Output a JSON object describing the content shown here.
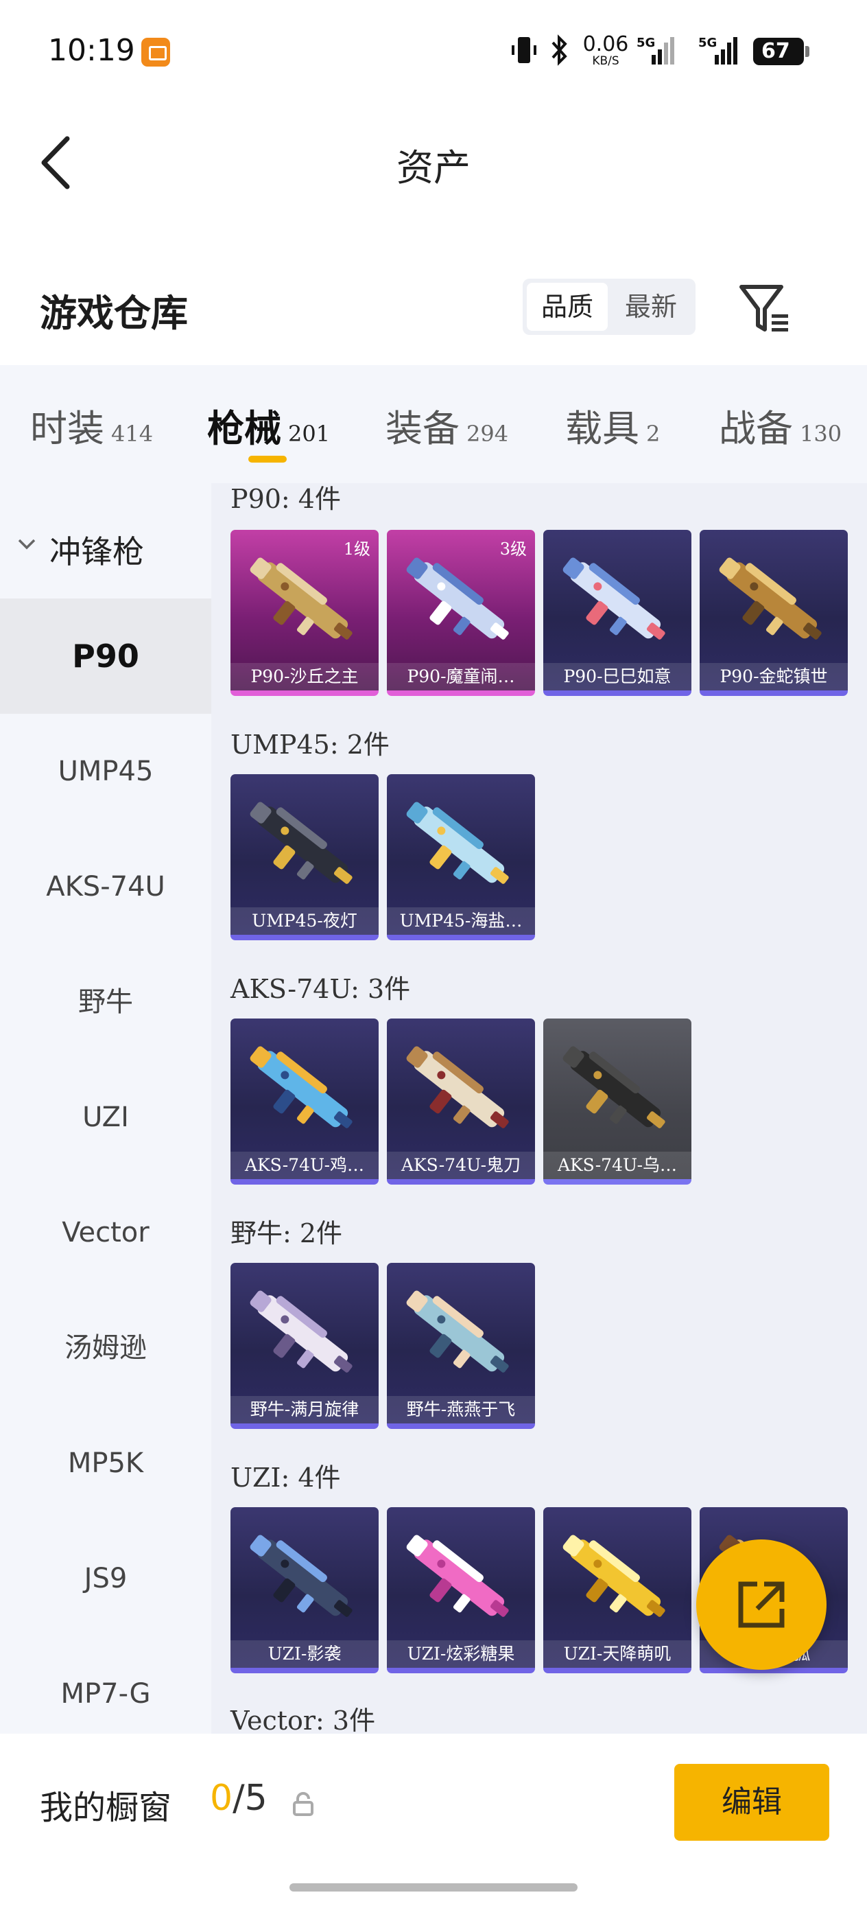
{
  "status_bar": {
    "time": "10:19",
    "net_speed": "0.06",
    "net_unit": "KB/S",
    "battery": "67",
    "signal_1": "5G",
    "signal_2": "5G"
  },
  "header": {
    "title": "资产"
  },
  "warehouse": {
    "title": "游戏仓库",
    "sort_options": [
      "品质",
      "最新"
    ]
  },
  "tabs": [
    {
      "label": "时装",
      "count": "414"
    },
    {
      "label": "枪械",
      "count": "201"
    },
    {
      "label": "装备",
      "count": "294"
    },
    {
      "label": "载具",
      "count": "2"
    },
    {
      "label": "战备",
      "count": "130"
    }
  ],
  "sidebar": {
    "group": "冲锋枪",
    "items": [
      "P90",
      "UMP45",
      "AKS-74U",
      "野牛",
      "UZI",
      "Vector",
      "汤姆逊",
      "MP5K",
      "JS9",
      "MP7-G"
    ]
  },
  "groups": [
    {
      "label": "P90: 4件",
      "cards": [
        {
          "name": "P90-沙丘之主",
          "level": "1级",
          "rarity": "legend",
          "palette": [
            "#c8a45a",
            "#e7d1a3",
            "#8a5a2b"
          ]
        },
        {
          "name": "P90-魔童闹…",
          "level": "3级",
          "rarity": "legend",
          "palette": [
            "#c9d7f2",
            "#5d7fc9",
            "#ffffff"
          ]
        },
        {
          "name": "P90-巳巳如意",
          "level": "",
          "rarity": "epic",
          "palette": [
            "#d7e2f7",
            "#6a8fd8",
            "#e96a7a"
          ]
        },
        {
          "name": "P90-金蛇镇世",
          "level": "",
          "rarity": "epic",
          "palette": [
            "#b8863a",
            "#e9c77b",
            "#6b4a22"
          ]
        }
      ]
    },
    {
      "label": "UMP45: 2件",
      "cards": [
        {
          "name": "UMP45-夜灯",
          "level": "",
          "rarity": "epic",
          "palette": [
            "#2c2f3a",
            "#6c7080",
            "#e0b340"
          ]
        },
        {
          "name": "UMP45-海盐…",
          "level": "",
          "rarity": "epic",
          "palette": [
            "#b9e0f2",
            "#5aa9d6",
            "#f2c34a"
          ]
        }
      ]
    },
    {
      "label": "AKS-74U: 3件",
      "cards": [
        {
          "name": "AKS-74U-鸡…",
          "level": "",
          "rarity": "epic",
          "palette": [
            "#5fb5e8",
            "#f0b53a",
            "#2c4d8a"
          ]
        },
        {
          "name": "AKS-74U-鬼刀",
          "level": "",
          "rarity": "epic",
          "palette": [
            "#e9dcc4",
            "#b8884f",
            "#8a2d2d"
          ]
        },
        {
          "name": "AKS-74U-乌…",
          "level": "",
          "rarity": "grey",
          "palette": [
            "#2a2a2a",
            "#4a4a4a",
            "#c99a3d"
          ]
        }
      ]
    },
    {
      "label": "野牛: 2件",
      "cards": [
        {
          "name": "野牛-满月旋律",
          "level": "",
          "rarity": "epic",
          "palette": [
            "#ece6f2",
            "#b7a8d6",
            "#6a5a8a"
          ]
        },
        {
          "name": "野牛-燕燕于飞",
          "level": "",
          "rarity": "epic",
          "palette": [
            "#9bc6d6",
            "#f0d7b8",
            "#3b5a7a"
          ]
        }
      ]
    },
    {
      "label": "UZI: 4件",
      "cards": [
        {
          "name": "UZI-影袭",
          "level": "",
          "rarity": "epic",
          "palette": [
            "#3c4a6a",
            "#7aa6e8",
            "#1e2233"
          ]
        },
        {
          "name": "UZI-炫彩糖果",
          "level": "",
          "rarity": "epic",
          "palette": [
            "#f06bc4",
            "#ffffff",
            "#b83a92"
          ]
        },
        {
          "name": "UZI-天降萌叽",
          "level": "",
          "rarity": "epic",
          "palette": [
            "#f2c530",
            "#fff2a8",
            "#c48a12"
          ]
        },
        {
          "name": "UZI-…狐",
          "level": "",
          "rarity": "epic",
          "palette": [
            "#e7b35a",
            "#7b4c2a",
            "#f2e0b8"
          ]
        }
      ]
    },
    {
      "label": "Vector: 3件",
      "cards": []
    }
  ],
  "showcase": {
    "label": "我的橱窗",
    "current": "0",
    "total": "/5"
  },
  "edit_button": "编辑",
  "colors": {
    "accent": "#f6b400",
    "legend_bottom": "#e15fd8",
    "epic_bottom": "#7064e6"
  },
  "icons": {
    "back": "chevron-left-icon",
    "filter": "filter-icon",
    "share": "external-link-icon",
    "lock": "lock-icon"
  }
}
